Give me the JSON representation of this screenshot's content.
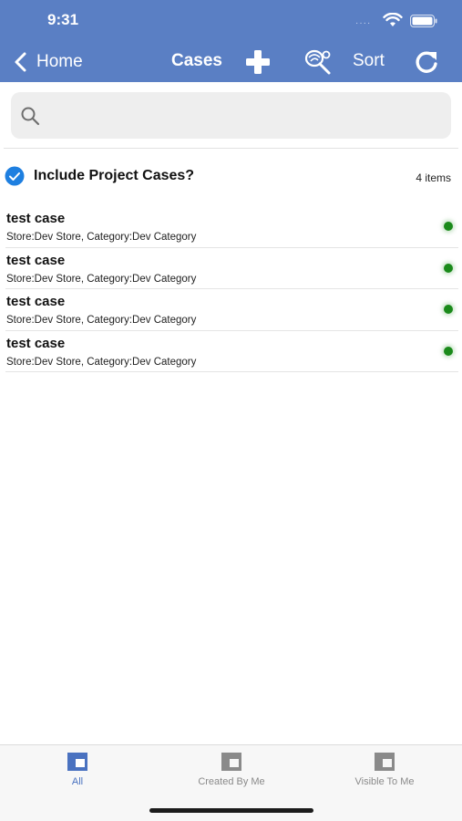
{
  "status_bar": {
    "time": "9:31",
    "signal": "····"
  },
  "header": {
    "back_label": "Home",
    "title": "Cases",
    "sort_label": "Sort",
    "background": "#5a7fc4"
  },
  "search": {
    "placeholder": "",
    "value": ""
  },
  "include_project_cases": {
    "label": "Include Project Cases?",
    "checked": true,
    "accent": "#1e7fe0"
  },
  "items_count": "4 items",
  "cases": [
    {
      "title": "test case",
      "subtitle": "Store:Dev Store, Category:Dev Category",
      "status_color": "#1a8a1a"
    },
    {
      "title": "test case",
      "subtitle": "Store:Dev Store, Category:Dev Category",
      "status_color": "#1a8a1a"
    },
    {
      "title": "test case",
      "subtitle": "Store:Dev Store, Category:Dev Category",
      "status_color": "#1a8a1a"
    },
    {
      "title": "test case",
      "subtitle": "Store:Dev Store, Category:Dev Category",
      "status_color": "#1a8a1a"
    }
  ],
  "tabs": [
    {
      "label": "All",
      "active": true
    },
    {
      "label": "Created By Me",
      "active": false
    },
    {
      "label": "Visible To Me",
      "active": false
    }
  ],
  "icons": {
    "back": "chevron-left-icon",
    "add": "plus-icon",
    "filter": "filter-icon",
    "refresh": "refresh-icon",
    "search": "search-icon",
    "check": "check-circle-icon",
    "tab": "tab-square-icon"
  }
}
